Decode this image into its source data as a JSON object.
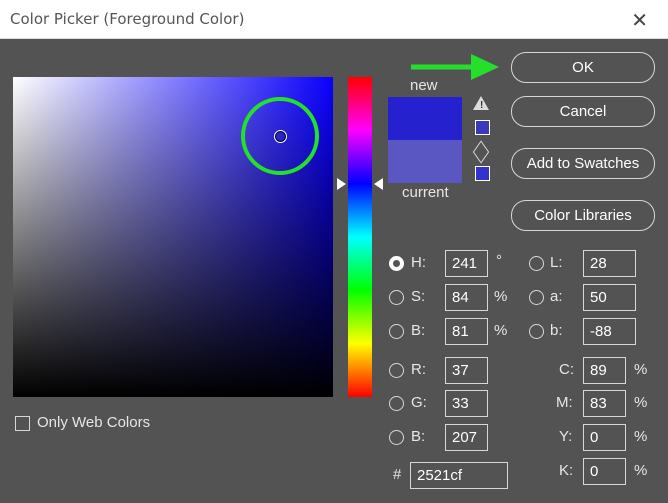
{
  "window": {
    "title": "Color Picker (Foreground Color)",
    "close_symbol": "✕"
  },
  "preview": {
    "new_label": "new",
    "current_label": "current",
    "new_color": "#2521cf",
    "current_color": "#5a57c2"
  },
  "buttons": {
    "ok": "OK",
    "cancel": "Cancel",
    "add_swatches": "Add to Swatches",
    "color_libraries": "Color Libraries"
  },
  "only_web_colors": "Only Web Colors",
  "hsb": {
    "h": {
      "label": "H:",
      "value": "241",
      "unit": "°"
    },
    "s": {
      "label": "S:",
      "value": "84",
      "unit": "%"
    },
    "b": {
      "label": "B:",
      "value": "81",
      "unit": "%"
    }
  },
  "rgb": {
    "r": {
      "label": "R:",
      "value": "37"
    },
    "g": {
      "label": "G:",
      "value": "33"
    },
    "b": {
      "label": "B:",
      "value": "207"
    }
  },
  "lab": {
    "l": {
      "label": "L:",
      "value": "28"
    },
    "a": {
      "label": "a:",
      "value": "50"
    },
    "b": {
      "label": "b:",
      "value": "-88"
    }
  },
  "cmyk": {
    "c": {
      "label": "C:",
      "value": "89",
      "unit": "%"
    },
    "m": {
      "label": "M:",
      "value": "83",
      "unit": "%"
    },
    "y": {
      "label": "Y:",
      "value": "0",
      "unit": "%"
    },
    "k": {
      "label": "K:",
      "value": "0",
      "unit": "%"
    }
  },
  "hex": {
    "label": "#",
    "value": "2521cf"
  },
  "colors": {
    "highlight": "#25e02a",
    "hue_base": "#0a00ff",
    "web_safe_color": "#3333cc"
  }
}
